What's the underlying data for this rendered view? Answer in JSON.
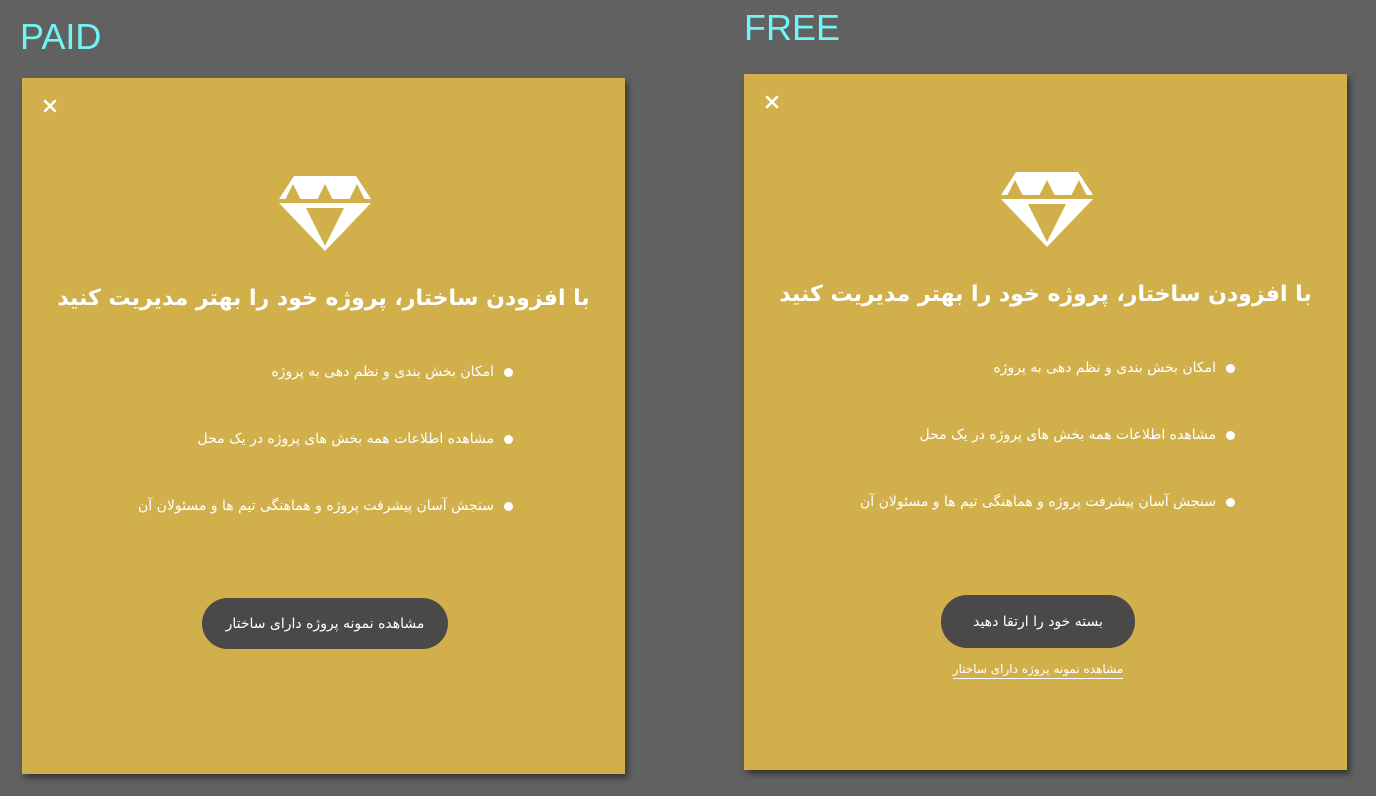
{
  "labels": {
    "paid": "PAID",
    "free": "FREE"
  },
  "colors": {
    "background": "#616161",
    "label": "#6ff5f5",
    "card": "#d1b04c",
    "button": "#4a4849",
    "text": "#ffffff"
  },
  "icons": {
    "close": "close-icon",
    "gem": "diamond-icon",
    "bullet": "bullet-icon"
  },
  "paid_card": {
    "title": "با افزودن ساختار، پروژه خود را بهتر مدیریت کنید",
    "features": [
      "امکان بخش بندی و نظم دهی به پروژه",
      "مشاهده اطلاعات همه بخش های پروژه در یک محل",
      "سنجش آسان پیشرفت پروژه و هماهنگی تیم ها و مسئولان آن"
    ],
    "button_label": "مشاهده نمونه پروژه دارای ساختار"
  },
  "free_card": {
    "title": "با افزودن ساختار، پروژه خود را بهتر مدیریت کنید",
    "features": [
      "امکان بخش بندی و نظم دهی به پروژه",
      "مشاهده اطلاعات همه بخش های پروژه در یک محل",
      "سنجش آسان پیشرفت پروژه و هماهنگی تیم ها و مسئولان آن"
    ],
    "button_label": "بسته خود را ارتقا دهید",
    "link_label": "مشاهده نمونه پروژه دارای ساختار"
  }
}
